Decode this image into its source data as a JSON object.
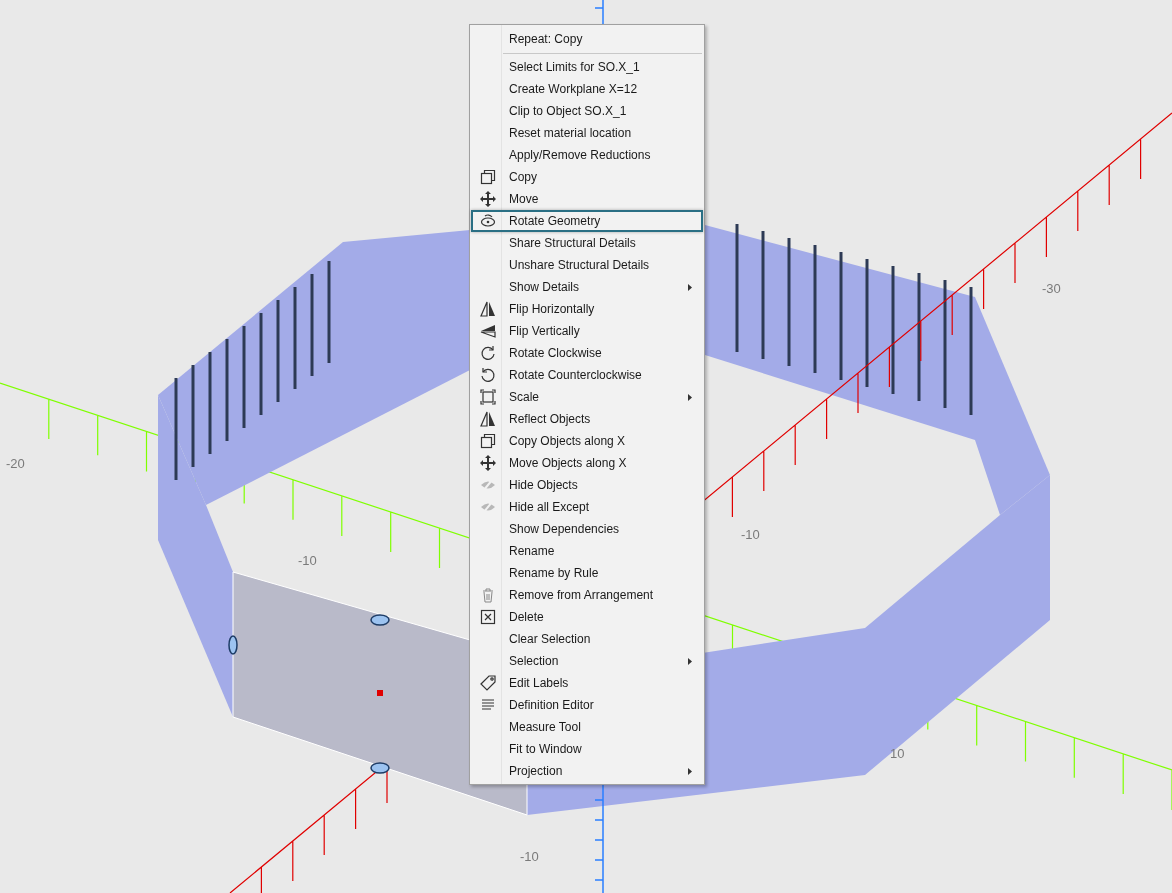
{
  "viewport": {
    "axis_labels": [
      {
        "text": "-30"
      },
      {
        "text": "-20"
      },
      {
        "text": "-10"
      },
      {
        "text": "-10"
      },
      {
        "text": "10"
      },
      {
        "text": "-10"
      }
    ]
  },
  "context_menu": {
    "items": [
      {
        "label": "Repeat: Copy",
        "selected": false
      },
      {
        "kind": "separator"
      },
      {
        "label": "Select Limits for SO.X_1",
        "selected": false
      },
      {
        "label": "Create Workplane X=12",
        "selected": false
      },
      {
        "label": "Clip to Object SO.X_1",
        "selected": false
      },
      {
        "label": "Reset material location",
        "selected": false
      },
      {
        "label": "Apply/Remove Reductions",
        "selected": false
      },
      {
        "label": "Copy",
        "kind": "copy",
        "selected": false
      },
      {
        "label": "Move",
        "kind": "move",
        "selected": false
      },
      {
        "label": "Rotate Geometry",
        "kind": "rotate",
        "selected": true
      },
      {
        "label": "Share Structural Details",
        "selected": false
      },
      {
        "label": "Unshare Structural Details",
        "selected": false
      },
      {
        "label": "Show Details",
        "submenu": true,
        "selected": false
      },
      {
        "label": "Flip Horizontally",
        "kind": "fliph",
        "selected": false
      },
      {
        "label": "Flip Vertically",
        "kind": "flipv",
        "selected": false
      },
      {
        "label": "Rotate Clockwise",
        "kind": "cw",
        "selected": false
      },
      {
        "label": "Rotate Counterclockwise",
        "kind": "ccw",
        "selected": false
      },
      {
        "label": "Scale",
        "kind": "scale",
        "submenu": true,
        "selected": false
      },
      {
        "label": "Reflect Objects",
        "kind": "fliph",
        "selected": false
      },
      {
        "label": "Copy Objects along X",
        "kind": "copy",
        "selected": false
      },
      {
        "label": "Move Objects along X",
        "kind": "move",
        "selected": false
      },
      {
        "label": "Hide Objects",
        "kind": "hide",
        "selected": false
      },
      {
        "label": "Hide all Except",
        "kind": "hide",
        "selected": false
      },
      {
        "label": "Show Dependencies",
        "selected": false
      },
      {
        "label": "Rename",
        "selected": false
      },
      {
        "label": "Rename by Rule",
        "selected": false
      },
      {
        "label": "Remove from Arrangement",
        "kind": "trash",
        "selected": false
      },
      {
        "label": "Delete",
        "kind": "delete",
        "selected": false
      },
      {
        "label": "Clear Selection",
        "selected": false
      },
      {
        "label": "Selection",
        "submenu": true,
        "selected": false
      },
      {
        "label": "Edit Labels",
        "kind": "tag",
        "selected": false
      },
      {
        "label": "Definition Editor",
        "kind": "lines",
        "selected": false
      },
      {
        "label": "Measure Tool",
        "selected": false
      },
      {
        "label": "Fit to Window",
        "selected": false
      },
      {
        "label": "Projection",
        "submenu": true,
        "selected": false
      }
    ]
  }
}
